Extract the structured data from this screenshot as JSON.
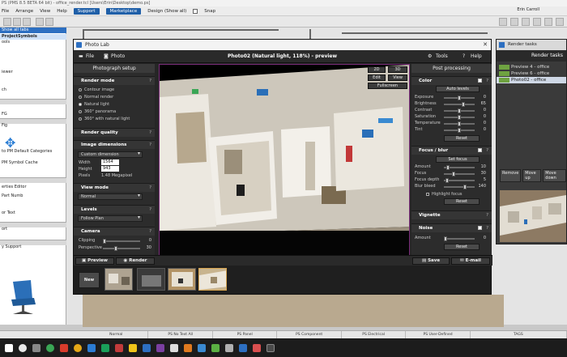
{
  "bg_app": {
    "title": "PS (PMS 8.5 BETA 64 bit) - office_render.tcl [Users\\Erin\\Desktop\\demo.ps]",
    "menu": [
      "File",
      "Arrange",
      "View",
      "Help"
    ],
    "support_label": "Support",
    "marketplace_label": "Marketplace",
    "design_label": "Design (Show all)",
    "snap_label": "Snap",
    "user_name": "Erin Carroll",
    "left_panel": {
      "tab_label": "Show all tabs",
      "items": [
        "ProjectSymbols",
        "ools",
        "iewer",
        "ch",
        "FG",
        "Fig",
        "to PM Default Categories",
        "PM Symbol Cache",
        "erties Editor",
        "Part Numb",
        "or Text",
        "ort",
        "y Support"
      ]
    },
    "status_bar": [
      "Normal",
      "PS No Text All",
      "PS Panel",
      "PS Component",
      "PS Electrical",
      "PS User-Defined",
      "TAGS"
    ]
  },
  "photo_lab": {
    "window_title": "Photo Lab",
    "menu_file": "File",
    "menu_photo": "Photo",
    "doc_title": "Photo02 (Natural light, 118%) - preview",
    "menu_tools": "Tools",
    "menu_help": "Help",
    "left_panel": {
      "title": "Photograph setup",
      "render_mode": {
        "label": "Render mode",
        "options": [
          "Contour image",
          "Normal render",
          "Natural light",
          "360° panorama",
          "360° with natural light"
        ],
        "selected_index": 2
      },
      "render_quality_label": "Render quality",
      "image_dimensions": {
        "label": "Image dimensions",
        "preset": "Custom dimension",
        "width_label": "Width",
        "width_value": "1564",
        "height_label": "Height",
        "height_value": "943",
        "pixels_label": "Pixels",
        "pixels_value": "1.48 Megapixel"
      },
      "view_mode": {
        "label": "View mode",
        "value": "Normal"
      },
      "levels": {
        "label": "Levels",
        "value": "Follow Plan"
      },
      "camera": {
        "label": "Camera",
        "clipping_label": "Clipping",
        "clipping_value": "0",
        "perspective_label": "Perspective",
        "perspective_value": "30"
      },
      "preview_button": "Preview",
      "render_button": "Render"
    },
    "viewport": {
      "btn_2d": "2D",
      "btn_3d": "3D",
      "btn_edit": "Edit",
      "btn_view": "View",
      "btn_fullscreen": "Fullscreen"
    },
    "right_panel": {
      "title": "Post processing",
      "color": {
        "label": "Color",
        "auto_levels": "Auto levels",
        "sliders": [
          {
            "label": "Exposure",
            "value": "0",
            "level": 0.5
          },
          {
            "label": "Brightness",
            "value": "65",
            "level": 0.65
          },
          {
            "label": "Contrast",
            "value": "0",
            "level": 0.5
          },
          {
            "label": "Saturation",
            "value": "0",
            "level": 0.5
          },
          {
            "label": "Temperature",
            "value": "0",
            "level": 0.5
          },
          {
            "label": "Tint",
            "value": "0",
            "level": 0.5
          }
        ],
        "reset": "Reset"
      },
      "focus_blur": {
        "label": "Focus / blur",
        "set_focus": "Set focus",
        "sliders": [
          {
            "label": "Amount",
            "value": "10",
            "level": 0.1
          },
          {
            "label": "Focus",
            "value": "30",
            "level": 0.3
          },
          {
            "label": "Focus depth",
            "value": "5",
            "level": 0.05
          },
          {
            "label": "Blur bleed",
            "value": "140",
            "level": 0.7
          }
        ],
        "highlight_label": "Highlight focus",
        "reset": "Reset"
      },
      "vignette_label": "Vignette",
      "noise": {
        "label": "Noise",
        "amount_label": "Amount",
        "amount_value": "0",
        "reset": "Reset"
      },
      "save_button": "Save",
      "email_button": "E-mail"
    },
    "new_button": "New"
  },
  "render_tasks": {
    "window_title": "Render tasks",
    "heading": "Render tasks",
    "items": [
      "Preview 4 - office",
      "Preview 6 - office",
      "Photo02 - office"
    ],
    "selected_index": 2,
    "remove_button": "Remove",
    "move_up_button": "Move up",
    "move_down_button": "Move down"
  },
  "colors": {
    "accent_blue": "#2d6fc1",
    "viewport_border": "#7a2c7a",
    "thumb_selected": "#d8a550"
  }
}
